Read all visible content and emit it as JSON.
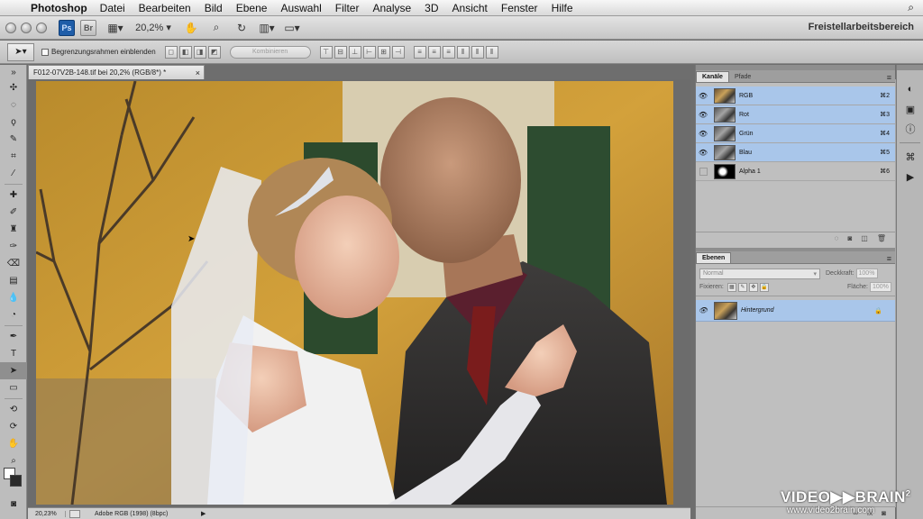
{
  "menubar": {
    "app": "Photoshop",
    "items": [
      "Datei",
      "Bearbeiten",
      "Bild",
      "Ebene",
      "Auswahl",
      "Filter",
      "Analyse",
      "3D",
      "Ansicht",
      "Fenster",
      "Hilfe"
    ]
  },
  "appbar": {
    "ps_label": "Ps",
    "br_label": "Br",
    "zoom": "20,2%",
    "workspace": "Freistellarbeitsbereich"
  },
  "optbar": {
    "checkbox_label": "Begrenzungsrahmen einblenden",
    "combine_label": "Kombinieren"
  },
  "document": {
    "tab_title": "F012-07V2B-148.tif bei 20,2% (RGB/8*) *",
    "status_zoom": "20,23%",
    "status_profile": "Adobe RGB (1998) (8bpc)"
  },
  "channels_panel": {
    "tabs": [
      "Kanäle",
      "Pfade"
    ],
    "rows": [
      {
        "name": "RGB",
        "key": "⌘2"
      },
      {
        "name": "Rot",
        "key": "⌘3"
      },
      {
        "name": "Grün",
        "key": "⌘4"
      },
      {
        "name": "Blau",
        "key": "⌘5"
      },
      {
        "name": "Alpha 1",
        "key": "⌘6"
      }
    ]
  },
  "layers_panel": {
    "tab": "Ebenen",
    "blend_mode": "Normal",
    "opacity_label": "Deckkraft:",
    "opacity_value": "100%",
    "lock_label": "Fixieren:",
    "fill_label": "Fläche:",
    "fill_value": "100%",
    "layer_name": "Hintergrund"
  },
  "watermark": {
    "brand": "VIDEO▶▶BRAIN",
    "sup": "2",
    "url": "www.video2brain.com"
  }
}
